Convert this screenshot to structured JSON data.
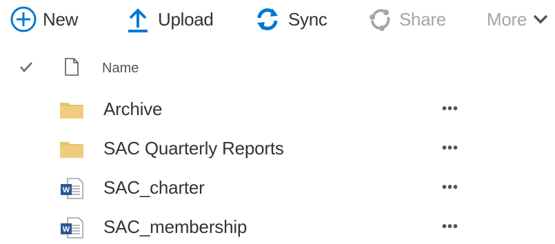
{
  "toolbar": {
    "new_label": "New",
    "upload_label": "Upload",
    "sync_label": "Sync",
    "share_label": "Share",
    "more_label": "More"
  },
  "list": {
    "column_name": "Name",
    "items": [
      {
        "name": "Archive",
        "type": "folder",
        "icon": "folder-icon"
      },
      {
        "name": "SAC Quarterly Reports",
        "type": "folder",
        "icon": "folder-icon"
      },
      {
        "name": "SAC_charter",
        "type": "word",
        "icon": "word-doc-icon"
      },
      {
        "name": "SAC_membership",
        "type": "word",
        "icon": "word-doc-icon"
      }
    ],
    "more_actions": "•••"
  },
  "colors": {
    "accent": "#0078d4",
    "folder": "#e8c36f",
    "disabled": "#a6a6a6",
    "text": "#333333"
  }
}
